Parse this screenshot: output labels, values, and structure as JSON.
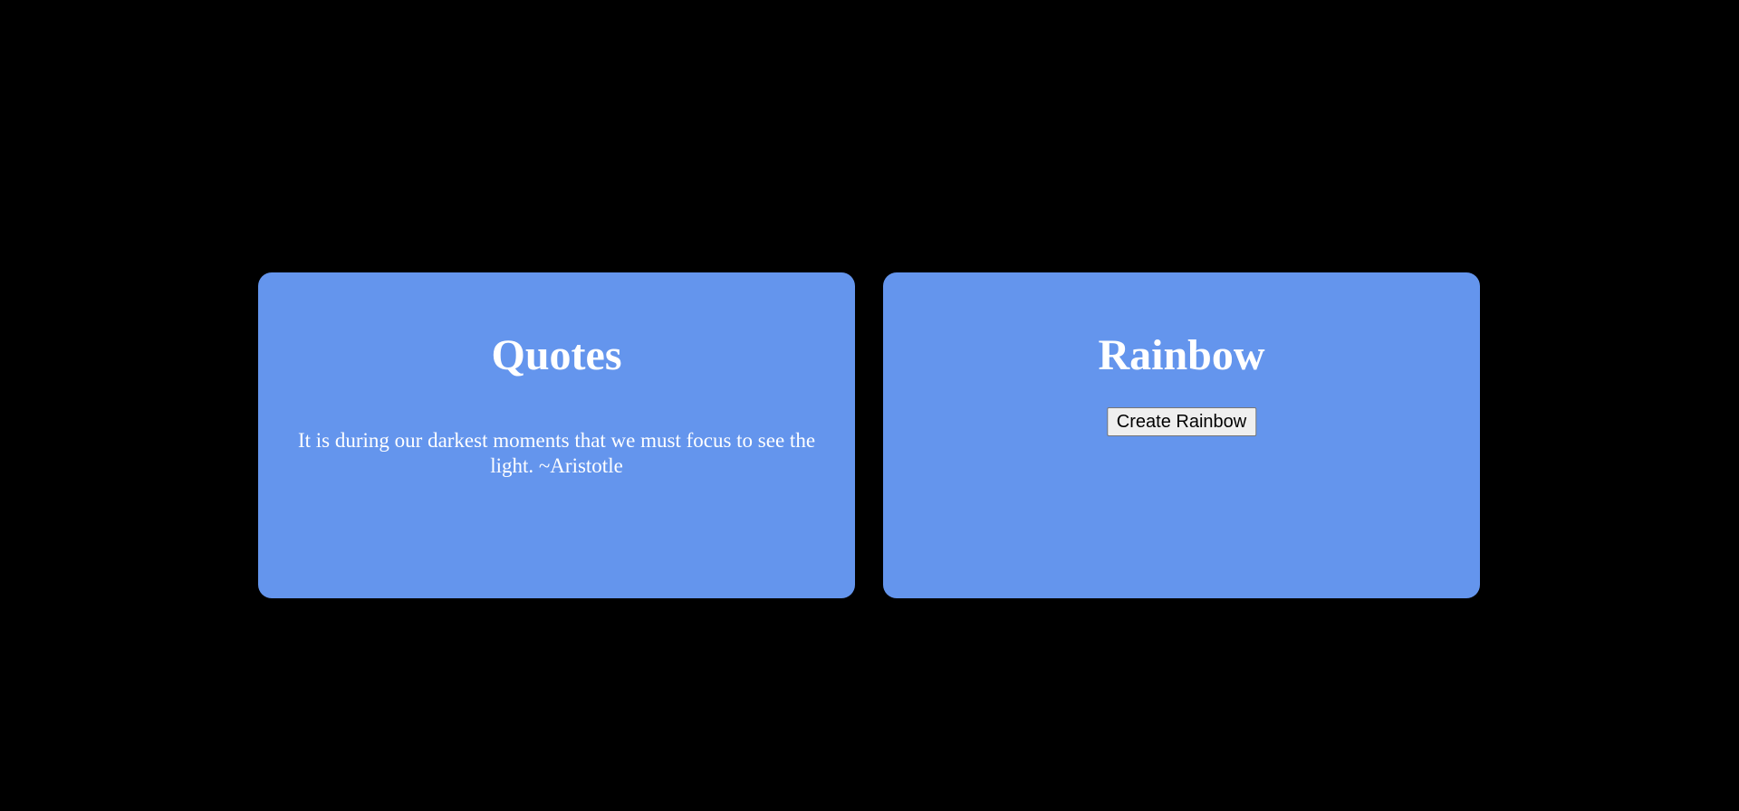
{
  "quotes_card": {
    "title": "Quotes",
    "quote": "It is during our darkest moments that we must focus to see the light. ~Aristotle"
  },
  "rainbow_card": {
    "title": "Rainbow",
    "button_label": "Create Rainbow"
  },
  "colors": {
    "background": "#000000",
    "card": "#6495ED",
    "text": "#ffffff"
  }
}
